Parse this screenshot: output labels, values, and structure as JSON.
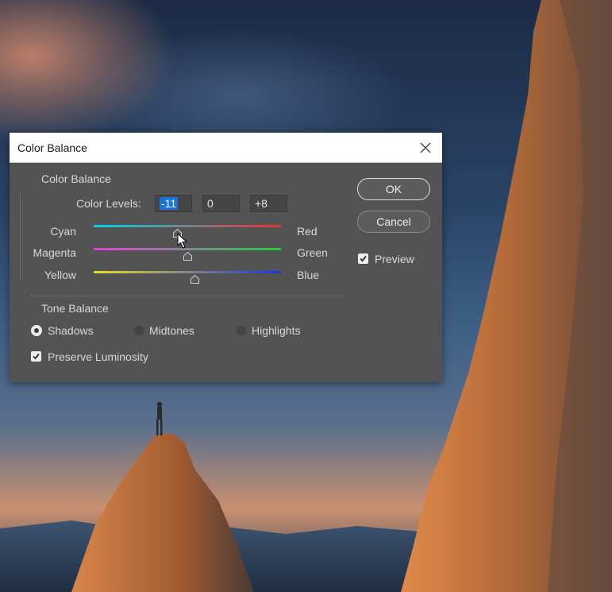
{
  "dialog": {
    "title": "Color Balance",
    "close_icon": "close-icon"
  },
  "color_balance": {
    "section_label": "Color Balance",
    "levels_label": "Color Levels:",
    "levels": [
      "-11",
      "0",
      "+8"
    ],
    "sliders": [
      {
        "left": "Cyan",
        "right": "Red",
        "value": -11,
        "min": -100,
        "max": 100,
        "colors": [
          "#00d4e8",
          "#e83030"
        ]
      },
      {
        "left": "Magenta",
        "right": "Green",
        "value": 0,
        "min": -100,
        "max": 100,
        "colors": [
          "#e040e0",
          "#20d040"
        ]
      },
      {
        "left": "Yellow",
        "right": "Blue",
        "value": 8,
        "min": -100,
        "max": 100,
        "colors": [
          "#e8e020",
          "#2030e8"
        ]
      }
    ]
  },
  "tone_balance": {
    "section_label": "Tone Balance",
    "options": [
      "Shadows",
      "Midtones",
      "Highlights"
    ],
    "selected": "Shadows",
    "preserve_label": "Preserve Luminosity",
    "preserve_checked": true
  },
  "buttons": {
    "ok": "OK",
    "cancel": "Cancel",
    "preview_label": "Preview",
    "preview_checked": true
  },
  "colors": {
    "panel": "#535353",
    "selection": "#1a72d8"
  }
}
